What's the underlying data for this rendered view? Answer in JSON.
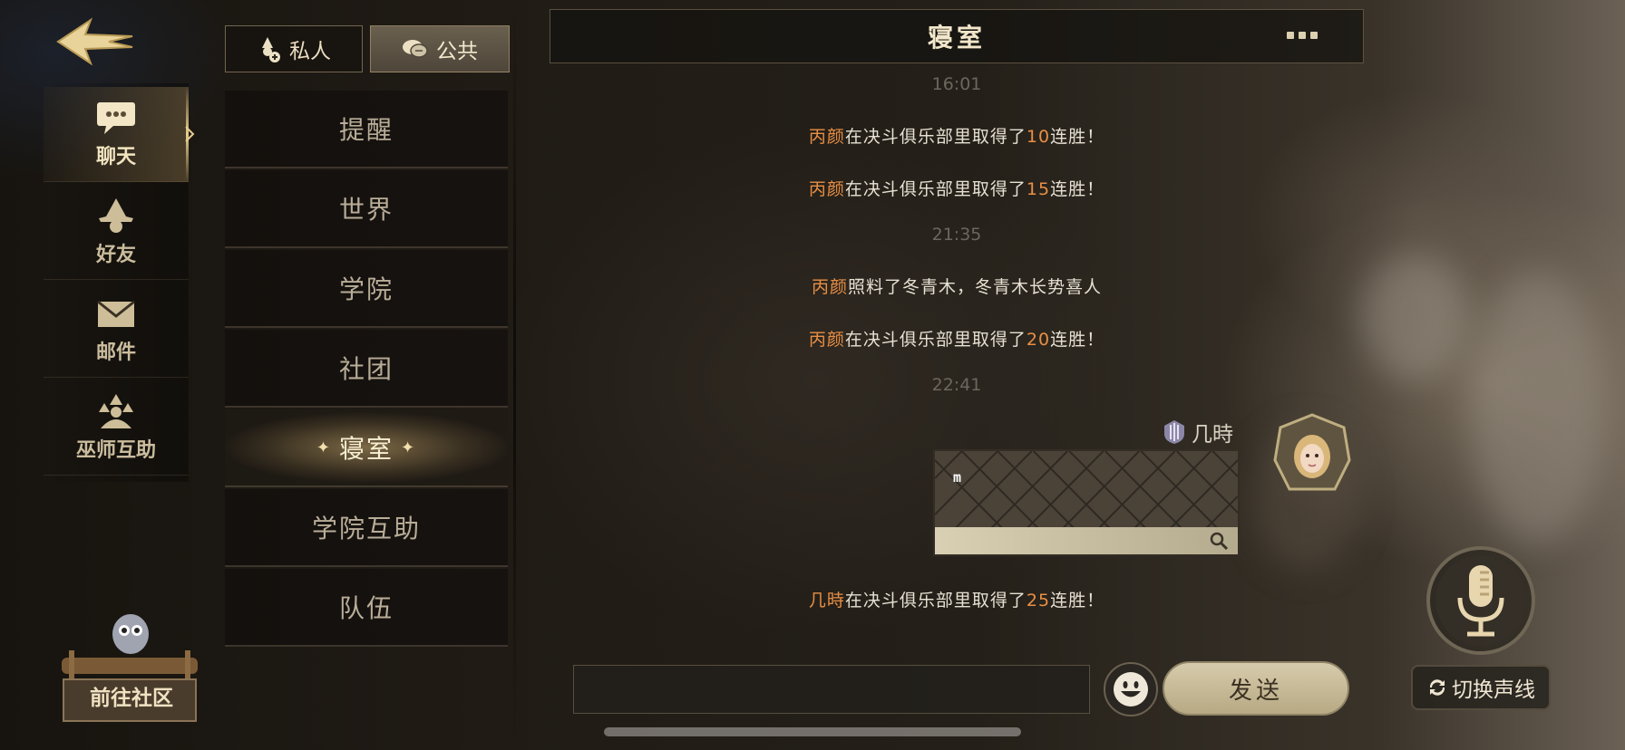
{
  "tabs": {
    "private_label": "私人",
    "public_label": "公共"
  },
  "nav": {
    "items": [
      {
        "label": "聊天",
        "icon": "chat-bubble-icon",
        "active": true
      },
      {
        "label": "好友",
        "icon": "wizard-hat-icon",
        "active": false
      },
      {
        "label": "邮件",
        "icon": "envelope-icon",
        "active": false
      },
      {
        "label": "巫师互助",
        "icon": "wizard-help-icon",
        "active": false
      }
    ],
    "community_label": "前往社区"
  },
  "channels": [
    {
      "label": "提醒",
      "active": false
    },
    {
      "label": "世界",
      "active": false
    },
    {
      "label": "学院",
      "active": false
    },
    {
      "label": "社团",
      "active": false
    },
    {
      "label": "寝室",
      "active": true
    },
    {
      "label": "学院互助",
      "active": false
    },
    {
      "label": "队伍",
      "active": false
    }
  ],
  "chat": {
    "title": "寝室",
    "times": [
      "16:01",
      "21:35",
      "22:41"
    ],
    "messages": [
      {
        "name": "丙颜",
        "pre": "在决斗俱乐部里取得了",
        "num": "10",
        "post": "连胜！"
      },
      {
        "name": "丙颜",
        "pre": "在决斗俱乐部里取得了",
        "num": "15",
        "post": "连胜！"
      },
      {
        "name": "丙颜",
        "pre": "照料了冬青木，冬青木长势喜人",
        "num": "",
        "post": ""
      },
      {
        "name": "丙颜",
        "pre": "在决斗俱乐部里取得了",
        "num": "20",
        "post": "连胜！"
      },
      {
        "name": "几時",
        "pre": "在决斗俱乐部里取得了",
        "num": "25",
        "post": "连胜！"
      }
    ],
    "sender_name": "几時",
    "bubble_text": "m"
  },
  "input": {
    "placeholder": "",
    "send_label": "发送"
  },
  "voice": {
    "switch_label": "切换声线"
  },
  "colors": {
    "highlight": "#e98f45",
    "gold": "#e6cd8e",
    "text": "#e7e0d3"
  }
}
